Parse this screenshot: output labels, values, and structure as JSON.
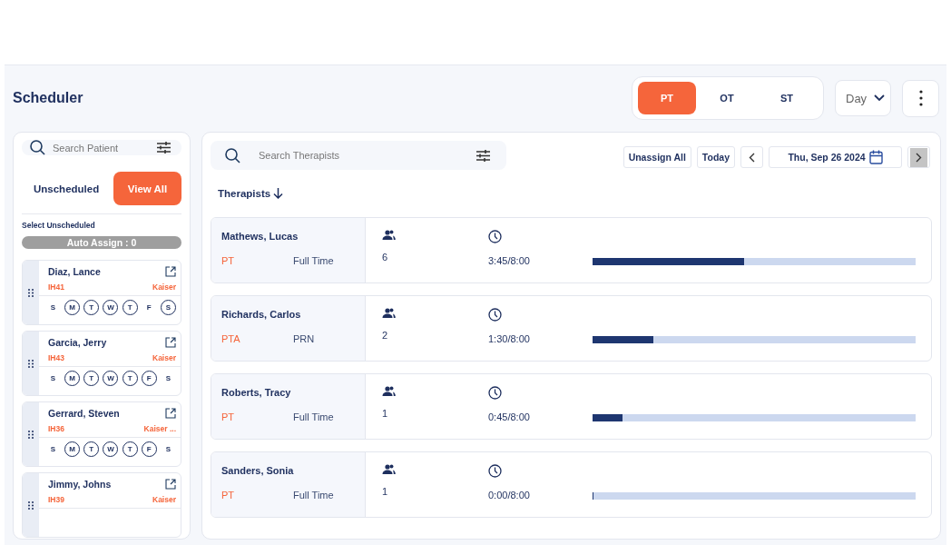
{
  "title": "Scheduler",
  "discipline_tabs": [
    {
      "label": "PT",
      "selected": true
    },
    {
      "label": "OT",
      "selected": false
    },
    {
      "label": "ST",
      "selected": false
    }
  ],
  "view_dropdown": {
    "value": "Day"
  },
  "patients_panel": {
    "search": {
      "placeholder": "Search Patient"
    },
    "tabs": [
      {
        "label": "Unscheduled",
        "selected": false
      },
      {
        "label": "View All",
        "selected": true
      }
    ],
    "select_label": "Select Unscheduled",
    "auto_assign": {
      "label": "Auto Assign : 0",
      "disabled": true
    },
    "patients": [
      {
        "name": "Diaz, Lance",
        "code": "IH41",
        "payer": "Kaiser",
        "days": [
          {
            "label": "S",
            "scheduled": false
          },
          {
            "label": "M",
            "scheduled": true
          },
          {
            "label": "T",
            "scheduled": true
          },
          {
            "label": "W",
            "scheduled": true
          },
          {
            "label": "T",
            "scheduled": true
          },
          {
            "label": "F",
            "scheduled": false
          },
          {
            "label": "S",
            "scheduled": true
          }
        ]
      },
      {
        "name": "Garcia, Jerry",
        "code": "IH43",
        "payer": "Kaiser",
        "days": [
          {
            "label": "S",
            "scheduled": false
          },
          {
            "label": "M",
            "scheduled": true
          },
          {
            "label": "T",
            "scheduled": true
          },
          {
            "label": "W",
            "scheduled": true
          },
          {
            "label": "T",
            "scheduled": true
          },
          {
            "label": "F",
            "scheduled": true
          },
          {
            "label": "S",
            "scheduled": false
          }
        ]
      },
      {
        "name": "Gerrard, Steven",
        "code": "IH36",
        "payer": "Kaiser ...",
        "days": [
          {
            "label": "S",
            "scheduled": false
          },
          {
            "label": "M",
            "scheduled": true
          },
          {
            "label": "T",
            "scheduled": true
          },
          {
            "label": "W",
            "scheduled": true
          },
          {
            "label": "T",
            "scheduled": true
          },
          {
            "label": "F",
            "scheduled": true
          },
          {
            "label": "S",
            "scheduled": false
          }
        ]
      },
      {
        "name": "Jimmy, Johns",
        "code": "IH39",
        "payer": "Kaiser"
      }
    ]
  },
  "therapists_panel": {
    "search": {
      "placeholder": "Search Therapists"
    },
    "unassign_all": "Unassign All",
    "today": "Today",
    "date": "Thu, Sep 26 2024",
    "sort_label": "Therapists",
    "therapists": [
      {
        "name": "Mathews, Lucas",
        "discipline": "PT",
        "employment": "Full Time",
        "visits": "6",
        "hours": "3:45/8:00",
        "level": 0.469
      },
      {
        "name": "Richards, Carlos",
        "discipline": "PTA",
        "employment": "PRN",
        "visits": "2",
        "hours": "1:30/8:00",
        "level": 0.1875
      },
      {
        "name": "Roberts, Tracy",
        "discipline": "PT",
        "employment": "Full Time",
        "visits": "1",
        "hours": "0:45/8:00",
        "level": 0.094
      },
      {
        "name": "Sanders, Sonia",
        "discipline": "PT",
        "employment": "Full Time",
        "visits": "1",
        "hours": "0:00/8:00",
        "level": 0
      }
    ]
  }
}
